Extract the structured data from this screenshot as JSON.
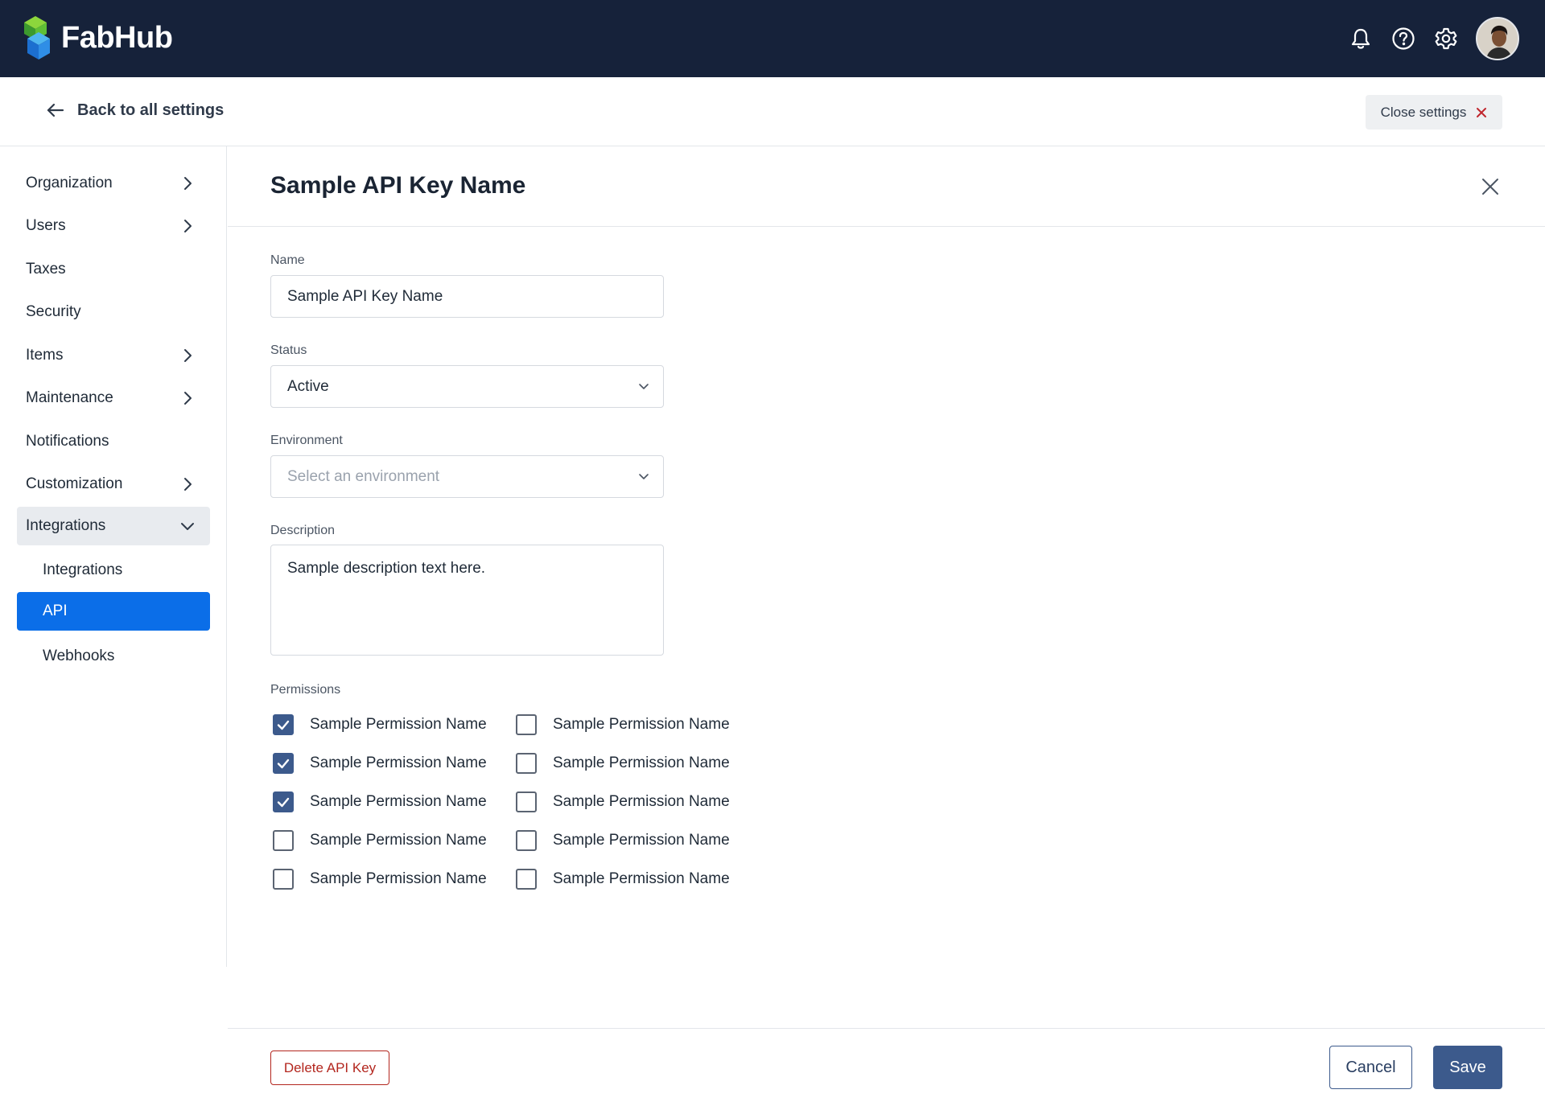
{
  "app": {
    "name": "FabHub"
  },
  "topbar": {
    "icons": [
      "bell-icon",
      "help-icon",
      "gear-icon"
    ],
    "avatar": "user-avatar"
  },
  "subheader": {
    "back_label": "Back to all settings",
    "close_label": "Close settings"
  },
  "sidebar": {
    "items": [
      {
        "label": "Organization",
        "chevron": "right"
      },
      {
        "label": "Users",
        "chevron": "right"
      },
      {
        "label": "Taxes",
        "chevron": ""
      },
      {
        "label": "Security",
        "chevron": ""
      },
      {
        "label": "Items",
        "chevron": "right"
      },
      {
        "label": "Maintenance",
        "chevron": "right"
      },
      {
        "label": "Notifications",
        "chevron": ""
      },
      {
        "label": "Customization",
        "chevron": "right"
      },
      {
        "label": "Integrations",
        "chevron": "down",
        "state": "expanded"
      }
    ],
    "subitems": [
      {
        "label": "Integrations"
      },
      {
        "label": "API",
        "state": "selected"
      },
      {
        "label": "Webhooks"
      }
    ]
  },
  "panel": {
    "title": "Sample API Key Name",
    "name": {
      "label": "Name",
      "value": "Sample API Key Name"
    },
    "status": {
      "label": "Status",
      "value": "Active"
    },
    "environment": {
      "label": "Environment",
      "placeholder": "Select an environment"
    },
    "description": {
      "label": "Description",
      "value": "Sample description text here."
    },
    "permissions": {
      "label": "Permissions",
      "items": [
        {
          "label": "Sample Permission Name",
          "checked": true
        },
        {
          "label": "Sample Permission Name",
          "checked": false
        },
        {
          "label": "Sample Permission Name",
          "checked": true
        },
        {
          "label": "Sample Permission Name",
          "checked": false
        },
        {
          "label": "Sample Permission Name",
          "checked": true
        },
        {
          "label": "Sample Permission Name",
          "checked": false
        },
        {
          "label": "Sample Permission Name",
          "checked": false
        },
        {
          "label": "Sample Permission Name",
          "checked": false
        },
        {
          "label": "Sample Permission Name",
          "checked": false
        },
        {
          "label": "Sample Permission Name",
          "checked": false
        }
      ]
    }
  },
  "footer": {
    "delete_label": "Delete API Key",
    "cancel_label": "Cancel",
    "save_label": "Save"
  },
  "colors": {
    "topbar": "#16223a",
    "active_nav": "#0b6ee8",
    "primary_button": "#3c5a8c",
    "danger": "#b3261e"
  }
}
